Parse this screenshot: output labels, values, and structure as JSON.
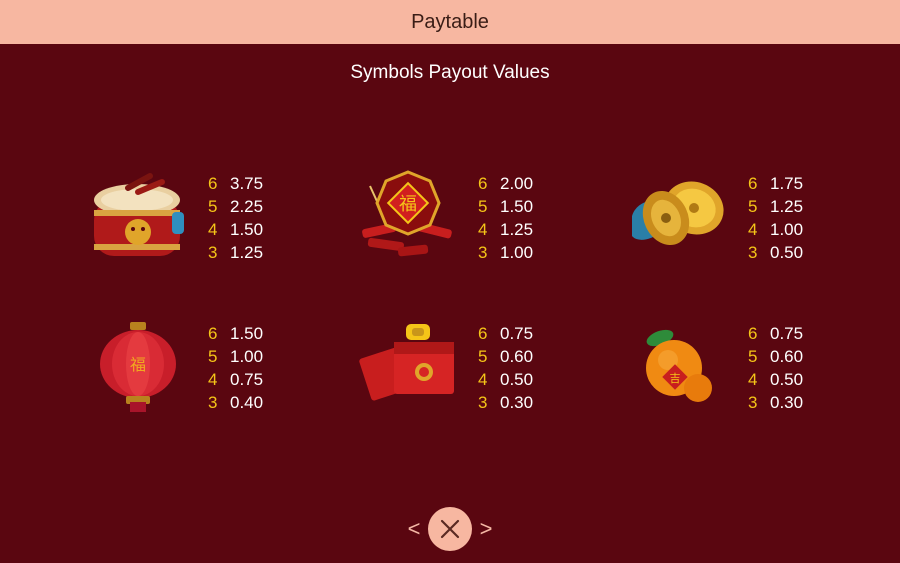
{
  "header": {
    "title": "Paytable"
  },
  "subtitle": "Symbols Payout Values",
  "symbols": [
    {
      "icon": "drum-icon",
      "pays": [
        {
          "count": "6",
          "value": "3.75"
        },
        {
          "count": "5",
          "value": "2.25"
        },
        {
          "count": "4",
          "value": "1.50"
        },
        {
          "count": "3",
          "value": "1.25"
        }
      ]
    },
    {
      "icon": "firecracker-fortune-icon",
      "pays": [
        {
          "count": "6",
          "value": "2.00"
        },
        {
          "count": "5",
          "value": "1.50"
        },
        {
          "count": "4",
          "value": "1.25"
        },
        {
          "count": "3",
          "value": "1.00"
        }
      ]
    },
    {
      "icon": "cymbals-icon",
      "pays": [
        {
          "count": "6",
          "value": "1.75"
        },
        {
          "count": "5",
          "value": "1.25"
        },
        {
          "count": "4",
          "value": "1.00"
        },
        {
          "count": "3",
          "value": "0.50"
        }
      ]
    },
    {
      "icon": "lantern-icon",
      "pays": [
        {
          "count": "6",
          "value": "1.50"
        },
        {
          "count": "5",
          "value": "1.00"
        },
        {
          "count": "4",
          "value": "0.75"
        },
        {
          "count": "3",
          "value": "0.40"
        }
      ]
    },
    {
      "icon": "red-envelope-icon",
      "pays": [
        {
          "count": "6",
          "value": "0.75"
        },
        {
          "count": "5",
          "value": "0.60"
        },
        {
          "count": "4",
          "value": "0.50"
        },
        {
          "count": "3",
          "value": "0.30"
        }
      ]
    },
    {
      "icon": "mandarin-orange-icon",
      "pays": [
        {
          "count": "6",
          "value": "0.75"
        },
        {
          "count": "5",
          "value": "0.60"
        },
        {
          "count": "4",
          "value": "0.50"
        },
        {
          "count": "3",
          "value": "0.30"
        }
      ]
    }
  ],
  "nav": {
    "prev": "<",
    "next": ">"
  },
  "colors": {
    "background": "#5a0610",
    "header": "#f7b7a1",
    "count": "#f5c518",
    "value": "#ffffff"
  }
}
